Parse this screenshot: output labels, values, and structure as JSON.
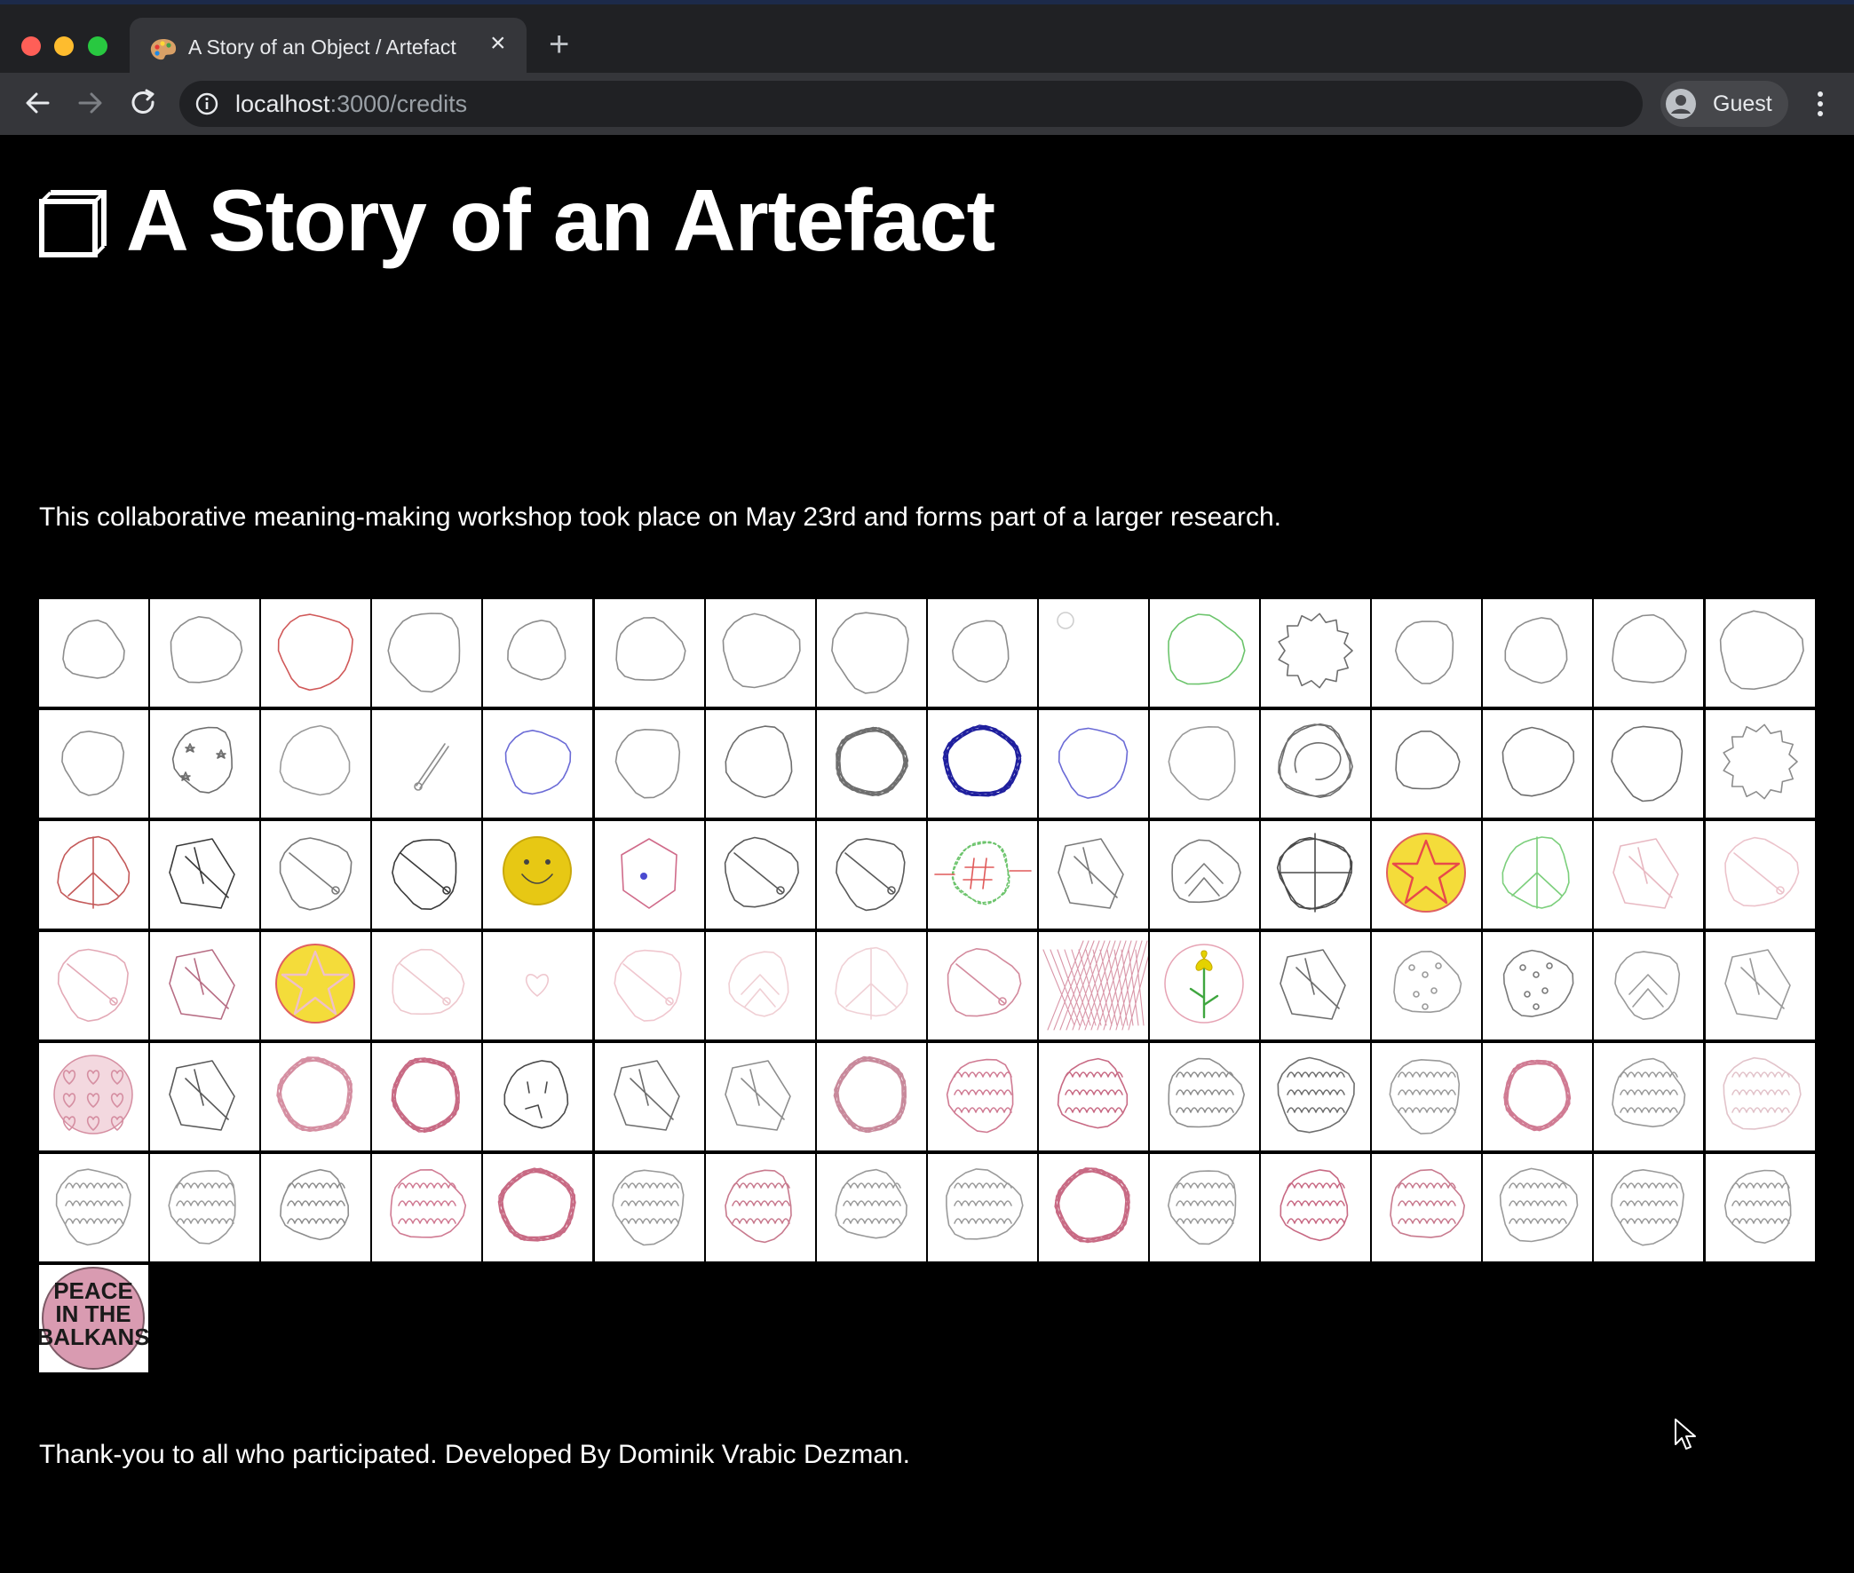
{
  "browser": {
    "tab_title": "A Story of an Object / Artefact",
    "tab_favicon": "palette-icon",
    "url_host": "localhost",
    "url_path": ":3000/credits",
    "profile_label": "Guest",
    "colors": {
      "close": "#ff5f57",
      "minimize": "#febc2e",
      "maximize": "#28c840"
    }
  },
  "page": {
    "title": "A Story of an Artefact",
    "logo_icon": "window-stack-icon",
    "intro": "This collaborative meaning-making workshop took place on May 23rd and forms part of a larger research.",
    "thanks": "Thank-you to all who participated. Developed By Dominik Vrabic Dezman."
  },
  "gallery": {
    "columns": 16,
    "tiles": [
      {
        "shape": "circle",
        "color": "#8d8d8d"
      },
      {
        "shape": "circle",
        "color": "#8d8d8d"
      },
      {
        "shape": "circle",
        "color": "#d05858"
      },
      {
        "shape": "circle",
        "color": "#8d8d8d"
      },
      {
        "shape": "circle",
        "color": "#8d8d8d"
      },
      {
        "shape": "circle",
        "color": "#8d8d8d"
      },
      {
        "shape": "circle",
        "color": "#8d8d8d"
      },
      {
        "shape": "circle",
        "color": "#8d8d8d"
      },
      {
        "shape": "circle",
        "color": "#8d8d8d"
      },
      {
        "shape": "dot",
        "color": "#cfcfcf"
      },
      {
        "shape": "circle",
        "color": "#6cc46c"
      },
      {
        "shape": "spiky",
        "color": "#6e6e6e"
      },
      {
        "shape": "circle",
        "color": "#8d8d8d"
      },
      {
        "shape": "circle",
        "color": "#8d8d8d"
      },
      {
        "shape": "circle",
        "color": "#8d8d8d"
      },
      {
        "shape": "circle",
        "color": "#8d8d8d"
      },
      {
        "shape": "circle",
        "color": "#8d8d8d"
      },
      {
        "shape": "stars",
        "color": "#6e6e6e"
      },
      {
        "shape": "circle",
        "color": "#9a9a9a"
      },
      {
        "shape": "stick",
        "color": "#8d8d8d"
      },
      {
        "shape": "circle",
        "color": "#6b6bd6"
      },
      {
        "shape": "circle",
        "color": "#8d8d8d"
      },
      {
        "shape": "circle",
        "color": "#6e6e6e"
      },
      {
        "shape": "scribble",
        "color": "#6e6e6e"
      },
      {
        "shape": "scribble",
        "color": "#1f1f9e"
      },
      {
        "shape": "circle",
        "color": "#6b6bd6"
      },
      {
        "shape": "circle",
        "color": "#9a9a9a"
      },
      {
        "shape": "swirl",
        "color": "#6e6e6e"
      },
      {
        "shape": "circle",
        "color": "#6e6e6e"
      },
      {
        "shape": "circle",
        "color": "#6e6e6e"
      },
      {
        "shape": "circle",
        "color": "#6e6e6e"
      },
      {
        "shape": "spiky",
        "color": "#8d8d8d"
      },
      {
        "shape": "peace",
        "color": "#c45a5a"
      },
      {
        "shape": "sketch",
        "color": "#3a3a3a"
      },
      {
        "shape": "pin",
        "color": "#7a7a7a"
      },
      {
        "shape": "pin",
        "color": "#3a3a3a"
      },
      {
        "shape": "smiley",
        "color": "#e7c814"
      },
      {
        "shape": "hexagon",
        "color": "#d06b8a"
      },
      {
        "shape": "pin",
        "color": "#5a5a5a"
      },
      {
        "shape": "pin",
        "color": "#5a5a5a"
      },
      {
        "shape": "hash",
        "color": "#6cc46c"
      },
      {
        "shape": "sketch",
        "color": "#7a7a7a"
      },
      {
        "shape": "chevron",
        "color": "#7a7a7a"
      },
      {
        "shape": "cross",
        "color": "#4a4a4a"
      },
      {
        "shape": "star",
        "color": "#e84a4a"
      },
      {
        "shape": "peace",
        "color": "#7ccf7c"
      },
      {
        "shape": "sketch",
        "color": "#e8b9c2"
      },
      {
        "shape": "pin",
        "color": "#ecc3cb"
      },
      {
        "shape": "pin",
        "color": "#e3a9b6"
      },
      {
        "shape": "sketch",
        "color": "#b76d84"
      },
      {
        "shape": "star",
        "color": "#efc0c8"
      },
      {
        "shape": "pin",
        "color": "#eec8ce"
      },
      {
        "shape": "heart",
        "color": "#efc8cf"
      },
      {
        "shape": "pin",
        "color": "#f0c7cf"
      },
      {
        "shape": "chevron",
        "color": "#f0cfd4"
      },
      {
        "shape": "peace",
        "color": "#f0d1d6"
      },
      {
        "shape": "pin",
        "color": "#d38a9d"
      },
      {
        "shape": "hatch",
        "color": "#d996a8"
      },
      {
        "shape": "flower",
        "color": "#e4d200"
      },
      {
        "shape": "sketch",
        "color": "#6e6e6e"
      },
      {
        "shape": "dots",
        "color": "#9a9a9a"
      },
      {
        "shape": "dots",
        "color": "#7a7a7a"
      },
      {
        "shape": "chevron",
        "color": "#9a9a9a"
      },
      {
        "shape": "sketch",
        "color": "#9a9a9a"
      },
      {
        "shape": "hearts",
        "color": "#d58ea1"
      },
      {
        "shape": "sketch",
        "color": "#5a5a5a"
      },
      {
        "shape": "scribble",
        "color": "#d58ea1"
      },
      {
        "shape": "scribble",
        "color": "#c86a84"
      },
      {
        "shape": "face",
        "color": "#4a4a4a"
      },
      {
        "shape": "sketch",
        "color": "#6e6e6e"
      },
      {
        "shape": "sketch",
        "color": "#8d8d8d"
      },
      {
        "shape": "scribble",
        "color": "#c8899b"
      },
      {
        "shape": "text",
        "color": "#d07b93"
      },
      {
        "shape": "text",
        "color": "#c86a84"
      },
      {
        "shape": "text",
        "color": "#8d8d8d"
      },
      {
        "shape": "text",
        "color": "#6e6e6e"
      },
      {
        "shape": "text",
        "color": "#9a9a9a"
      },
      {
        "shape": "scribble",
        "color": "#d07b93"
      },
      {
        "shape": "text",
        "color": "#9a9a9a"
      },
      {
        "shape": "text",
        "color": "#e2c3ca"
      },
      {
        "shape": "text",
        "color": "#9a9a9a"
      },
      {
        "shape": "text",
        "color": "#9a9a9a"
      },
      {
        "shape": "text",
        "color": "#8d8d8d"
      },
      {
        "shape": "text",
        "color": "#d07b93"
      },
      {
        "shape": "scribble",
        "color": "#c86a84"
      },
      {
        "shape": "text",
        "color": "#9a9a9a"
      },
      {
        "shape": "text",
        "color": "#c87a8e"
      },
      {
        "shape": "text",
        "color": "#9a9a9a"
      },
      {
        "shape": "text",
        "color": "#9a9a9a"
      },
      {
        "shape": "scribble",
        "color": "#c86a84"
      },
      {
        "shape": "text",
        "color": "#9a9a9a"
      },
      {
        "shape": "text",
        "color": "#c86a84"
      },
      {
        "shape": "text",
        "color": "#c87a8e"
      },
      {
        "shape": "text",
        "color": "#9a9a9a"
      },
      {
        "shape": "text",
        "color": "#9a9a9a"
      },
      {
        "shape": "text",
        "color": "#9a9a9a"
      },
      {
        "shape": "badge",
        "color": "#d99bb1",
        "label_lines": [
          "PEACE",
          "IN THE",
          "BALKANS"
        ]
      }
    ]
  }
}
